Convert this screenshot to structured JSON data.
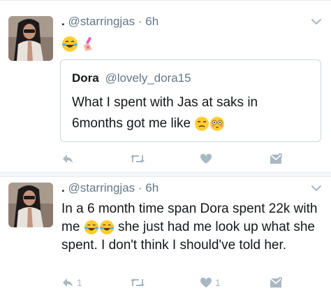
{
  "tweets": [
    {
      "display_name": ".",
      "handle": "@starringjas",
      "separator": "·",
      "time": "6h",
      "quoted": {
        "name": "Dora",
        "handle": "@lovely_dora15",
        "text": "What I spent with Jas at saks in 6months got me like"
      },
      "actions": {
        "reply_count": "",
        "retweet_count": "",
        "like_count": ""
      }
    },
    {
      "display_name": ".",
      "handle": "@starringjas",
      "separator": "·",
      "time": "6h",
      "text_part1": "In a 6 month time span Dora spent 22k with me",
      "text_part2": "she just had me look up what she spent. I don't think I should've told her.",
      "actions": {
        "reply_count": "1",
        "retweet_count": "",
        "like_count": "1"
      }
    }
  ],
  "colors": {
    "icon_gray": "#aab8c2",
    "secondary_text": "#657786",
    "emoji_yellow": "#ffcc33"
  },
  "icons": [
    "chevron-down-icon",
    "reply-icon",
    "retweet-icon",
    "like-icon",
    "direct-message-icon"
  ]
}
